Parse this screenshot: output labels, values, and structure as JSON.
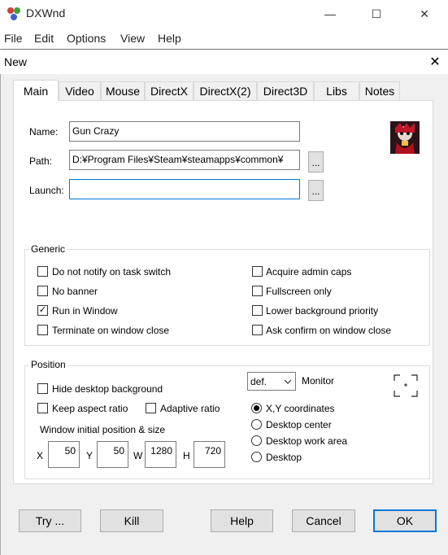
{
  "window": {
    "title": "DXWnd",
    "controls": {
      "minimize": "—",
      "maximize": "☐",
      "close": "✕"
    }
  },
  "menu": [
    "File",
    "Edit",
    "Options",
    "View",
    "Help"
  ],
  "dialog": {
    "title": "New",
    "close": "✕",
    "tabs": [
      "Main",
      "Video",
      "Mouse",
      "DirectX",
      "DirectX(2)",
      "Direct3D",
      "Libs",
      "Notes"
    ],
    "active_tab": "Main",
    "fields": {
      "name_label": "Name:",
      "name_value": "Gun Crazy",
      "path_label": "Path:",
      "path_value": "D:¥Program Files¥Steam¥steamapps¥common¥",
      "launch_label": "Launch:",
      "launch_value": "",
      "browse_label": "..."
    },
    "generic": {
      "title": "Generic",
      "options": [
        {
          "label": "Do not notify on task switch",
          "checked": false
        },
        {
          "label": "No banner",
          "checked": false
        },
        {
          "label": "Run in Window",
          "checked": true
        },
        {
          "label": "Terminate on window close",
          "checked": false
        },
        {
          "label": "Acquire admin caps",
          "checked": false
        },
        {
          "label": "Fullscreen only",
          "checked": false
        },
        {
          "label": "Lower background priority",
          "checked": false
        },
        {
          "label": "Ask confirm on window close",
          "checked": false
        }
      ]
    },
    "position": {
      "title": "Position",
      "hide_desktop": {
        "label": "Hide desktop background",
        "checked": false
      },
      "keep_aspect": {
        "label": "Keep aspect ratio",
        "checked": false
      },
      "adaptive": {
        "label": "Adaptive ratio",
        "checked": false
      },
      "initial_label": "Window initial position & size",
      "x_label": "X",
      "x_value": "50",
      "y_label": "Y",
      "y_value": "50",
      "w_label": "W",
      "w_value": "1280",
      "h_label": "H",
      "h_value": "720",
      "monitor_value": "def.",
      "monitor_label": "Monitor",
      "radios": [
        {
          "label": "X,Y coordinates",
          "selected": true
        },
        {
          "label": "Desktop center",
          "selected": false
        },
        {
          "label": "Desktop work area",
          "selected": false
        },
        {
          "label": "Desktop",
          "selected": false
        }
      ]
    },
    "buttons": {
      "try": "Try ...",
      "kill": "Kill",
      "help": "Help",
      "cancel": "Cancel",
      "ok": "OK"
    }
  },
  "colors": {
    "accent": "#0078d7",
    "panel": "#ffffff",
    "background": "#f0f0f0"
  }
}
